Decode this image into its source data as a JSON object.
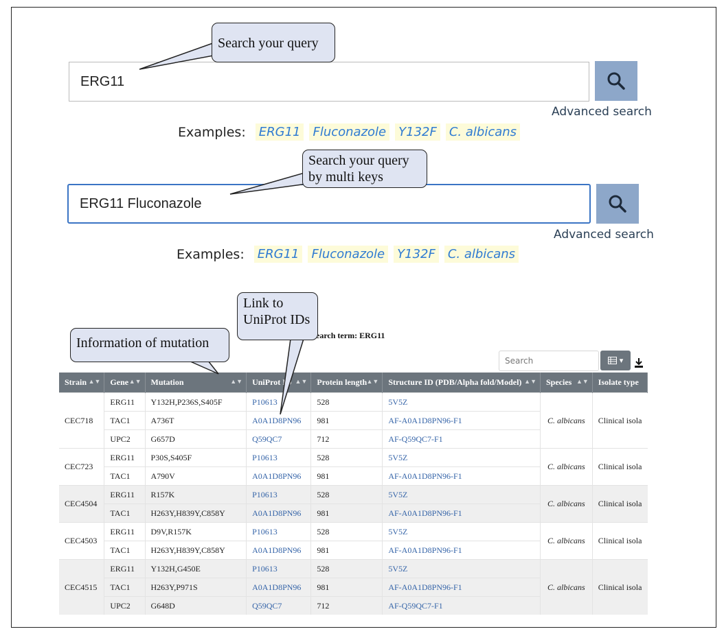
{
  "callouts": {
    "search_query": "Search your query",
    "multi_keys_line1": "Search your query",
    "multi_keys_line2": "by multi keys",
    "uniprot_line1": "Link to",
    "uniprot_line2": "UniProt IDs",
    "mutation_info": "Information of mutation"
  },
  "search1": {
    "value": "ERG11",
    "advanced_label": "Advanced search"
  },
  "search2": {
    "value": "ERG11 Fluconazole",
    "advanced_label": "Advanced search"
  },
  "examples": {
    "label": "Examples:",
    "items": [
      "ERG11",
      "Fluconazole",
      "Y132F",
      "C. albicans"
    ]
  },
  "results": {
    "search_term_label": "earch term: ERG11",
    "search_placeholder": "Search",
    "columns": [
      "Strain",
      "Gene",
      "Mutation",
      "UniProt ID",
      "Protein length",
      "Structure ID (PDB/Alpha fold/Model)",
      "Species",
      "Isolate type"
    ],
    "rows": [
      {
        "strain": "CEC718",
        "species": "C. albicans",
        "isolate": "Clinical isola",
        "shade": false,
        "genes": [
          {
            "gene": "ERG11",
            "mutation": "Y132H,P236S,S405F",
            "uniprot": "P10613",
            "length": "528",
            "structure": "5V5Z"
          },
          {
            "gene": "TAC1",
            "mutation": "A736T",
            "uniprot": "A0A1D8PN96",
            "length": "981",
            "structure": "AF-A0A1D8PN96-F1"
          },
          {
            "gene": "UPC2",
            "mutation": "G657D",
            "uniprot": "Q59QC7",
            "length": "712",
            "structure": "AF-Q59QC7-F1"
          }
        ]
      },
      {
        "strain": "CEC723",
        "species": "C. albicans",
        "isolate": "Clinical isola",
        "shade": false,
        "genes": [
          {
            "gene": "ERG11",
            "mutation": "P30S,S405F",
            "uniprot": "P10613",
            "length": "528",
            "structure": "5V5Z"
          },
          {
            "gene": "TAC1",
            "mutation": "A790V",
            "uniprot": "A0A1D8PN96",
            "length": "981",
            "structure": "AF-A0A1D8PN96-F1"
          }
        ]
      },
      {
        "strain": "CEC4504",
        "species": "C. albicans",
        "isolate": "Clinical isola",
        "shade": true,
        "genes": [
          {
            "gene": "ERG11",
            "mutation": "R157K",
            "uniprot": "P10613",
            "length": "528",
            "structure": "5V5Z"
          },
          {
            "gene": "TAC1",
            "mutation": "H263Y,H839Y,C858Y",
            "uniprot": "A0A1D8PN96",
            "length": "981",
            "structure": "AF-A0A1D8PN96-F1"
          }
        ]
      },
      {
        "strain": "CEC4503",
        "species": "C. albicans",
        "isolate": "Clinical isola",
        "shade": false,
        "genes": [
          {
            "gene": "ERG11",
            "mutation": "D9V,R157K",
            "uniprot": "P10613",
            "length": "528",
            "structure": "5V5Z"
          },
          {
            "gene": "TAC1",
            "mutation": "H263Y,H839Y,C858Y",
            "uniprot": "A0A1D8PN96",
            "length": "981",
            "structure": "AF-A0A1D8PN96-F1"
          }
        ]
      },
      {
        "strain": "CEC4515",
        "species": "C. albicans",
        "isolate": "Clinical isola",
        "shade": true,
        "genes": [
          {
            "gene": "ERG11",
            "mutation": "Y132H,G450E",
            "uniprot": "P10613",
            "length": "528",
            "structure": "5V5Z"
          },
          {
            "gene": "TAC1",
            "mutation": "H263Y,P971S",
            "uniprot": "A0A1D8PN96",
            "length": "981",
            "structure": "AF-A0A1D8PN96-F1"
          },
          {
            "gene": "UPC2",
            "mutation": "G648D",
            "uniprot": "Q59QC7",
            "length": "712",
            "structure": "AF-Q59QC7-F1"
          }
        ]
      }
    ]
  },
  "colors": {
    "accent": "#3a74c4",
    "search_button": "#8da7c9",
    "header": "#6c757d",
    "callout": "#dfe4f2",
    "link": "#3564a8",
    "chip": "#fdfbd9"
  },
  "icons": {
    "search_button": "search-icon",
    "column_toggle": "columns-icon",
    "download": "download-icon"
  }
}
